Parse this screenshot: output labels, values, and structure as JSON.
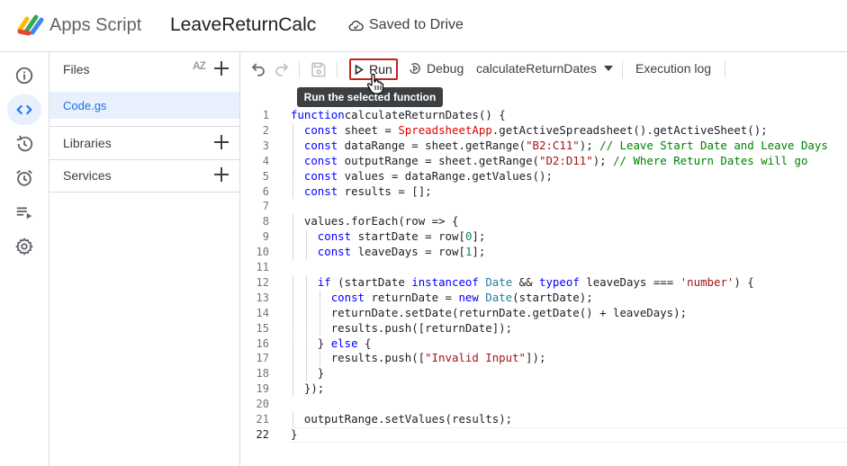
{
  "header": {
    "app_name": "Apps Script",
    "project_title": "LeaveReturnCalc",
    "save_status": "Saved to Drive"
  },
  "sidebar": {
    "items": [
      {
        "name": "overview",
        "icon": "info-icon"
      },
      {
        "name": "editor",
        "icon": "code-icon",
        "active": true
      },
      {
        "name": "executions",
        "icon": "history-icon"
      },
      {
        "name": "triggers",
        "icon": "alarm-icon"
      },
      {
        "name": "executions-list",
        "icon": "playlist-icon"
      },
      {
        "name": "project-settings",
        "icon": "gear-icon"
      }
    ]
  },
  "files_panel": {
    "files_label": "Files",
    "sort_label": "AZ",
    "file_name": "Code.gs",
    "libraries_label": "Libraries",
    "services_label": "Services"
  },
  "toolbar": {
    "run_label": "Run",
    "debug_label": "Debug",
    "function_name": "calculateReturnDates",
    "execution_log_label": "Execution log",
    "tooltip": "Run the selected function"
  },
  "editor": {
    "current_line": 22,
    "lines": [
      "1",
      "2",
      "3",
      "4",
      "5",
      "6",
      "7",
      "8",
      "9",
      "10",
      "11",
      "12",
      "13",
      "14",
      "15",
      "16",
      "17",
      "18",
      "19",
      "20",
      "21",
      "22"
    ],
    "code": {
      "l1": [
        [
          "kw",
          "function"
        ],
        [
          "",
          "calculateReturnDates() {"
        ]
      ],
      "l2": [
        [
          "kw",
          "const"
        ],
        [
          "",
          " sheet = "
        ],
        [
          "obj",
          "SpreadsheetApp"
        ],
        [
          "",
          ".getActiveSpreadsheet().getActiveSheet();"
        ]
      ],
      "l3": [
        [
          "kw",
          "const"
        ],
        [
          "",
          " dataRange = sheet.getRange("
        ],
        [
          "str",
          "\"B2:C11\""
        ],
        [
          "",
          "); "
        ],
        [
          "cmt",
          "// Leave Start Date and Leave Days"
        ]
      ],
      "l4": [
        [
          "kw",
          "const"
        ],
        [
          "",
          " outputRange = sheet.getRange("
        ],
        [
          "str",
          "\"D2:D11\""
        ],
        [
          "",
          "); "
        ],
        [
          "cmt",
          "// Where Return Dates will go"
        ]
      ],
      "l5": [
        [
          "kw",
          "const"
        ],
        [
          "",
          " values = dataRange.getValues();"
        ]
      ],
      "l6": [
        [
          "kw",
          "const"
        ],
        [
          "",
          " results = [];"
        ]
      ],
      "l7": [],
      "l8": [
        [
          "",
          "values.forEach(row => {"
        ]
      ],
      "l9": [
        [
          "kw",
          "const"
        ],
        [
          "",
          " startDate = row["
        ],
        [
          "num",
          "0"
        ],
        [
          "",
          "];"
        ]
      ],
      "l10": [
        [
          "kw",
          "const"
        ],
        [
          "",
          " leaveDays = row["
        ],
        [
          "num",
          "1"
        ],
        [
          "",
          "];"
        ]
      ],
      "l11": [],
      "l12": [
        [
          "kw",
          "if"
        ],
        [
          "",
          " (startDate "
        ],
        [
          "kw",
          "instanceof"
        ],
        [
          "",
          ""
        ],
        [
          "cls",
          " Date"
        ],
        [
          "",
          " && "
        ],
        [
          "kw",
          "typeof"
        ],
        [
          "",
          " leaveDays === "
        ],
        [
          "str",
          "'number'"
        ],
        [
          "",
          ") {"
        ]
      ],
      "l13": [
        [
          "kw",
          "const"
        ],
        [
          "",
          " returnDate = "
        ],
        [
          "kw",
          "new"
        ],
        [
          "cls",
          " Date"
        ],
        [
          "",
          "(startDate);"
        ]
      ],
      "l14": [
        [
          "",
          "returnDate.setDate(returnDate.getDate() + leaveDays);"
        ]
      ],
      "l15": [
        [
          "",
          "results.push([returnDate]);"
        ]
      ],
      "l16": [
        [
          "",
          "} "
        ],
        [
          "kw",
          "else"
        ],
        [
          "",
          " {"
        ]
      ],
      "l17": [
        [
          "",
          "results.push(["
        ],
        [
          "str",
          "\"Invalid Input\""
        ],
        [
          "",
          "]);"
        ]
      ],
      "l18": [
        [
          "",
          "}"
        ]
      ],
      "l19": [
        [
          "",
          "});"
        ]
      ],
      "l20": [],
      "l21": [
        [
          "",
          "outputRange.setValues(results);"
        ]
      ],
      "l22": [
        [
          "",
          "}"
        ]
      ]
    },
    "indent": [
      0,
      1,
      1,
      1,
      1,
      1,
      0,
      1,
      2,
      2,
      0,
      2,
      3,
      3,
      3,
      2,
      3,
      2,
      1,
      0,
      1,
      0
    ]
  },
  "colors": {
    "accent": "#1a73e8",
    "run_highlight": "#c5221f",
    "keyword": "#0000ff",
    "string": "#a31515",
    "comment": "#008000"
  }
}
